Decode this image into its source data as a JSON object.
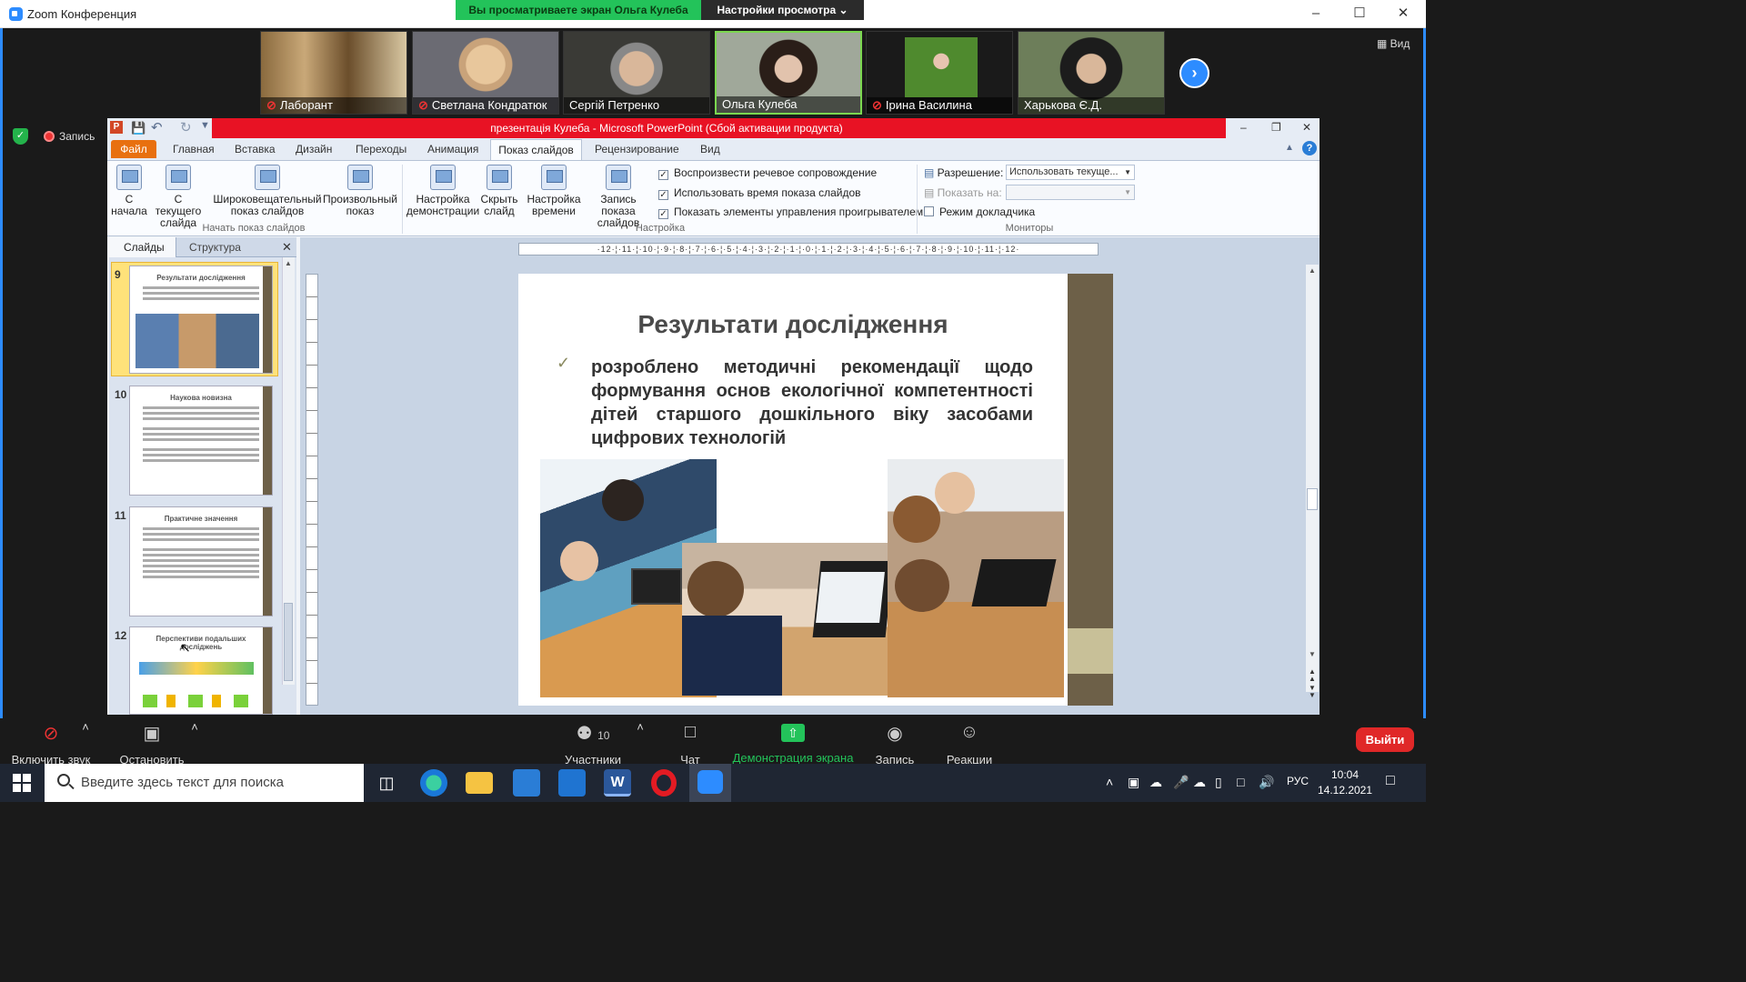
{
  "zoom": {
    "window_title": "Zoom Конференция",
    "share_banner": "Вы просматриваете экран Ольга Кулеба",
    "view_options": "Настройки просмотра ⌄",
    "view_label": "Вид",
    "record_label": "Запись",
    "participants": [
      {
        "name": "Лаборант",
        "muted": true
      },
      {
        "name": "Светлана Кондратюк",
        "muted": true
      },
      {
        "name": "Сергій Петренко",
        "muted": false
      },
      {
        "name": "Ольга Кулеба",
        "muted": false
      },
      {
        "name": "Ірина Василина",
        "muted": true
      },
      {
        "name": "Харькова Є.Д.",
        "muted": false
      }
    ],
    "controls": {
      "unmute": "Включить звук",
      "stop_video": "Остановить видео",
      "participants": "Участники",
      "participants_count": "10",
      "chat": "Чат",
      "share": "Демонстрация экрана",
      "record": "Запись",
      "reactions": "Реакции",
      "leave": "Выйти"
    }
  },
  "ppt": {
    "title": "презентація Кулеба - Microsoft PowerPoint (Сбой активации продукта)",
    "tabs": [
      "Файл",
      "Главная",
      "Вставка",
      "Дизайн",
      "Переходы",
      "Анимация",
      "Показ слайдов",
      "Рецензирование",
      "Вид"
    ],
    "ribbon": {
      "from_start": "С начала",
      "from_current": "С текущего слайда",
      "broadcast": "Широковещательный показ слайдов",
      "custom": "Произвольный показ",
      "group_start": "Начать показ слайдов",
      "setup": "Настройка демонстрации",
      "hide": "Скрыть слайд",
      "timing": "Настройка времени",
      "record": "Запись показа слайдов",
      "chk_narration": "Воспроизвести речевое сопровождение",
      "chk_timings": "Использовать время показа слайдов",
      "chk_controls": "Показать элементы управления проигрывателем",
      "group_setup": "Настройка",
      "resolution_label": "Разрешение:",
      "resolution_value": "Использовать текуще...",
      "show_on_label": "Показать на:",
      "presenter": "Режим докладчика",
      "group_monitors": "Мониторы"
    },
    "pane_tabs": [
      "Слайды",
      "Структура"
    ],
    "thumbnails": [
      {
        "num": "9",
        "title": "Результати дослідження"
      },
      {
        "num": "10",
        "title": "Наукова новизна"
      },
      {
        "num": "11",
        "title": "Практичне значення"
      },
      {
        "num": "12",
        "title": "Перспективи подальших досліджень"
      }
    ],
    "ruler": "·12·¦·11·¦·10·¦·9·¦·8·¦·7·¦·6·¦·5·¦·4·¦·3·¦·2·¦·1·¦·0·¦·1·¦·2·¦·3·¦·4·¦·5·¦·6·¦·7·¦·8·¦·9·¦·10·¦·11·¦·12·",
    "slide": {
      "title": "Результати дослідження",
      "bullet": "розроблено методичні рекомендації щодо формування основ екологічної компетентності дітей старшого дошкільного віку засобами цифрових технологій"
    }
  },
  "taskbar": {
    "search_placeholder": "Введите здесь текст для поиска",
    "lang": "РУС",
    "time": "10:04",
    "date": "14.12.2021"
  },
  "colors": {
    "zoom_blue": "#2d8cff",
    "ppt_red": "#e81224",
    "share_green": "#23c35a",
    "file_orange": "#e8700f"
  }
}
